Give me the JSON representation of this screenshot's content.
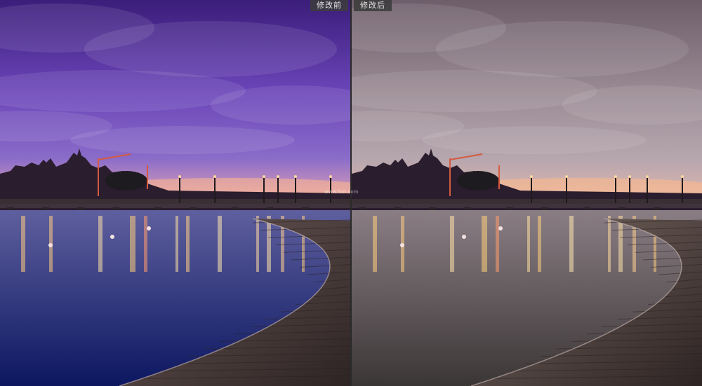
{
  "labels": {
    "before": "修改前",
    "after": "修改后"
  },
  "watermark": "www.lian.com",
  "panels": [
    {
      "id": "before",
      "sky_top": "#3b1d7a",
      "sky_mid": "#6a45b8",
      "sky_low": "#8a6cc9",
      "horizon": "#e7a6b4",
      "water_top": "#5e5f9e",
      "water_bottom": "#0c1760",
      "boardwalk": "#6b5a58"
    },
    {
      "id": "after",
      "sky_top": "#6e5e6a",
      "sky_mid": "#9a8a93",
      "sky_low": "#b6a6ae",
      "horizon": "#e2b8ae",
      "water_top": "#8a7e84",
      "water_bottom": "#3b3636",
      "boardwalk": "#7a6a62"
    }
  ]
}
